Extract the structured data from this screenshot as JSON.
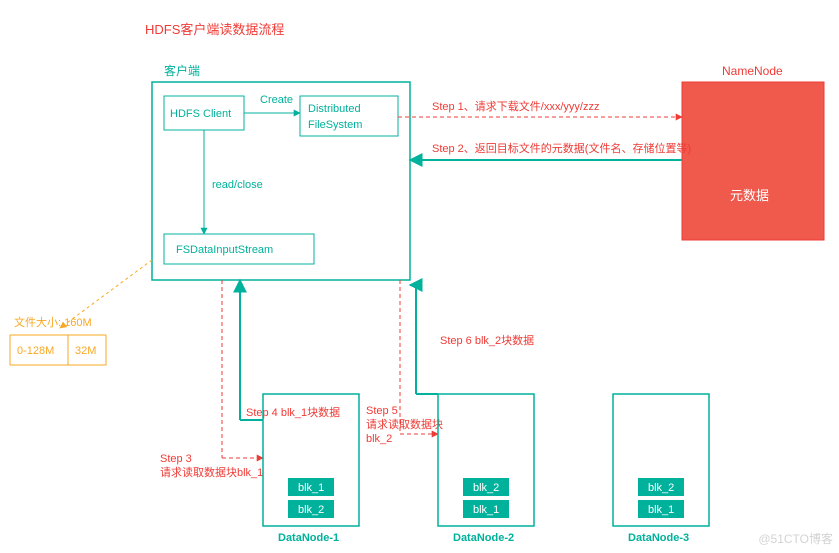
{
  "title": "HDFS客户端读数据流程",
  "client": {
    "label": "客户端",
    "hdfs_client": "HDFS Client",
    "create": "Create",
    "dfs": "Distributed\nFileSystem",
    "read_close": "read/close",
    "input_stream": "FSDataInputStream"
  },
  "namenode": {
    "label": "NameNode",
    "meta": "元数据"
  },
  "steps": {
    "s1": "Step 1、请求下载文件/xxx/yyy/zzz",
    "s2": "Step 2、返回目标文件的元数据(文件名、存储位置等)",
    "s3": "Step 3\n请求读取数据块blk_1",
    "s4": "Step 4 blk_1块数据",
    "s5": "Step 5\n请求读取数据块\nblk_2",
    "s6": "Step 6 blk_2块数据"
  },
  "file": {
    "size_label": "文件大小: 160M",
    "block_a": "0-128M",
    "block_b": "32M"
  },
  "datanodes": {
    "d1": {
      "label": "DataNode-1",
      "b1": "blk_1",
      "b2": "blk_2"
    },
    "d2": {
      "label": "DataNode-2",
      "b1": "blk_2",
      "b2": "blk_1"
    },
    "d3": {
      "label": "DataNode-3",
      "b1": "blk_2",
      "b2": "blk_1"
    }
  },
  "watermark": "@51CTO博客",
  "colors": {
    "green": "#00b19c",
    "red": "#ef3b36",
    "orange": "#f9a825",
    "node_fill": "#ef5a4d"
  }
}
